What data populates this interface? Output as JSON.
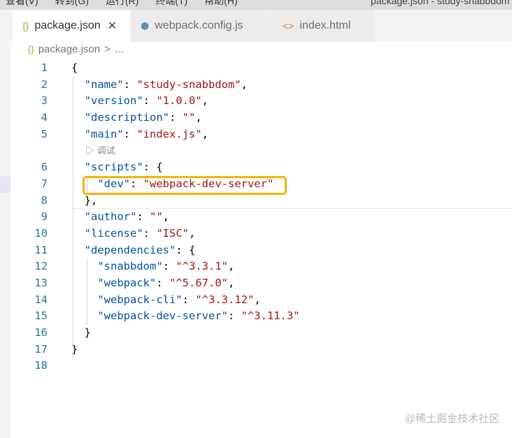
{
  "menu": {
    "items": [
      "查看(V)",
      "转到(G)",
      "运行(R)",
      "终端(T)",
      "帮助(H)"
    ],
    "title": "package.json - study-snabbdom"
  },
  "tabs": [
    {
      "label": "package.json",
      "icon": "json-braces-icon",
      "close": "✕"
    },
    {
      "label": "webpack.config.js",
      "icon": "webpack-cube-icon"
    },
    {
      "label": "index.html",
      "icon": "html-brackets-icon"
    }
  ],
  "breadcrumb": {
    "file": "package.json",
    "sep": ">",
    "rest": "..."
  },
  "codelens": "▷ 调试",
  "lines": [
    {
      "n": "1",
      "ind": "",
      "k": "",
      "p": "{",
      "s": "",
      "t": ""
    },
    {
      "n": "2",
      "ind": "  ",
      "k": "\"name\"",
      "p": ": ",
      "s": "\"study-snabbdom\"",
      "t": ","
    },
    {
      "n": "3",
      "ind": "  ",
      "k": "\"version\"",
      "p": ": ",
      "s": "\"1.0.0\"",
      "t": ","
    },
    {
      "n": "4",
      "ind": "  ",
      "k": "\"description\"",
      "p": ": ",
      "s": "\"\"",
      "t": ","
    },
    {
      "n": "5",
      "ind": "  ",
      "k": "\"main\"",
      "p": ": ",
      "s": "\"index.js\"",
      "t": ","
    },
    {
      "n": "6",
      "ind": "  ",
      "k": "\"scripts\"",
      "p": ": {",
      "s": "",
      "t": ""
    },
    {
      "n": "7",
      "ind": "    ",
      "k": "\"dev\"",
      "p": ": ",
      "s": "\"webpack-dev-server\"",
      "t": ""
    },
    {
      "n": "8",
      "ind": "  ",
      "k": "",
      "p": "},",
      "s": "",
      "t": ""
    },
    {
      "n": "9",
      "ind": "  ",
      "k": "\"author\"",
      "p": ": ",
      "s": "\"\"",
      "t": ","
    },
    {
      "n": "10",
      "ind": "  ",
      "k": "\"license\"",
      "p": ": ",
      "s": "\"ISC\"",
      "t": ","
    },
    {
      "n": "11",
      "ind": "  ",
      "k": "\"dependencies\"",
      "p": ": {",
      "s": "",
      "t": ""
    },
    {
      "n": "12",
      "ind": "    ",
      "k": "\"snabbdom\"",
      "p": ": ",
      "s": "\"^3.3.1\"",
      "t": ","
    },
    {
      "n": "13",
      "ind": "    ",
      "k": "\"webpack\"",
      "p": ": ",
      "s": "\"^5.67.0\"",
      "t": ","
    },
    {
      "n": "14",
      "ind": "    ",
      "k": "\"webpack-cli\"",
      "p": ": ",
      "s": "\"^3.3.12\"",
      "t": ","
    },
    {
      "n": "15",
      "ind": "    ",
      "k": "\"webpack-dev-server\"",
      "p": ": ",
      "s": "\"^3.11.3\"",
      "t": ""
    },
    {
      "n": "16",
      "ind": "  ",
      "k": "",
      "p": "}",
      "s": "",
      "t": ""
    },
    {
      "n": "17",
      "ind": "",
      "k": "",
      "p": "}",
      "s": "",
      "t": ""
    },
    {
      "n": "18",
      "ind": "",
      "k": "",
      "p": "",
      "s": "",
      "t": ""
    }
  ],
  "watermark": "@稀土掘金技术社区"
}
